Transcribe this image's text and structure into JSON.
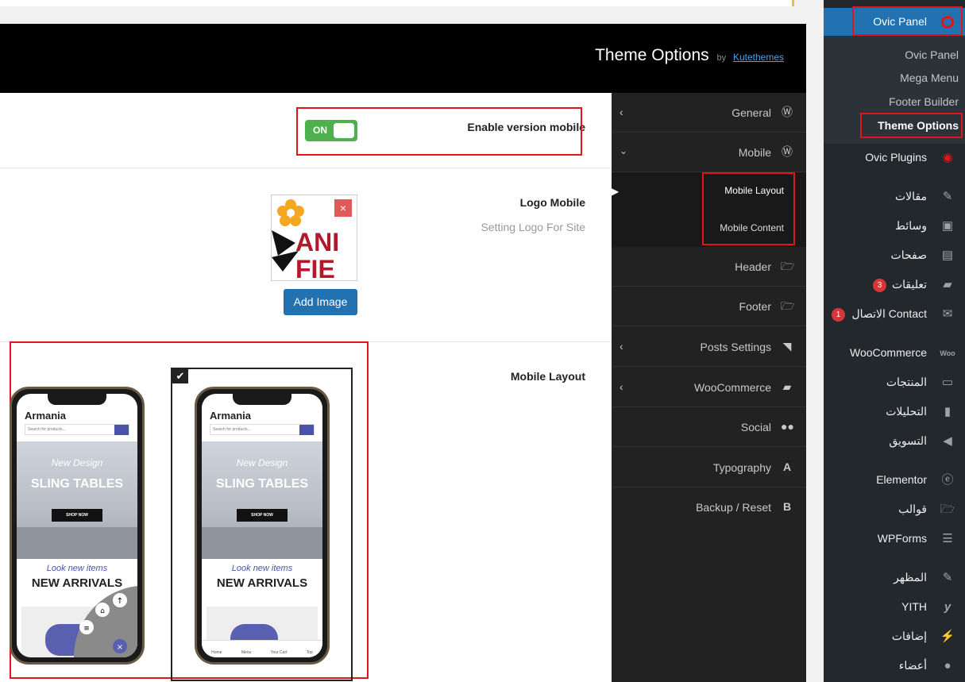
{
  "header": {
    "title": "Theme Options",
    "by": "by",
    "author": "Kutethemes"
  },
  "rows": {
    "enable_mobile": {
      "label": "Enable version mobile",
      "toggle": "ON"
    },
    "logo_mobile": {
      "label": "Logo Mobile",
      "sub": "Setting Logo For Site",
      "add_button": "Add Image",
      "remove": "×",
      "logo_text_1": "ANI",
      "logo_text_2": "FIE"
    },
    "mobile_layout": {
      "label": "Mobile Layout"
    }
  },
  "phones": [
    {
      "brand": "Armania",
      "search": "Search for products...",
      "hero_script": "New Design",
      "hero_title": "SLING TABLES",
      "shop": "SHOP NOW",
      "look": "Look new items",
      "arrivals": "NEW ARRIVALS"
    },
    {
      "brand": "Armania",
      "search": "Search for products...",
      "hero_script": "New Design",
      "hero_title": "SLING TABLES",
      "shop": "SHOP NOW",
      "look": "Look new items",
      "arrivals": "NEW ARRIVALS",
      "nav": [
        "Home",
        "Menu",
        "Your Cart",
        "Top"
      ]
    }
  ],
  "options_menu": {
    "items": [
      {
        "label": "General",
        "icon": "wordpress-icon"
      },
      {
        "label": "Mobile",
        "icon": "wordpress-icon"
      },
      {
        "label": "Header",
        "icon": "folder-icon"
      },
      {
        "label": "Footer",
        "icon": "folder-icon"
      },
      {
        "label": "Posts Settings",
        "icon": "rss-icon"
      },
      {
        "label": "WooCommerce",
        "icon": "bag-icon"
      },
      {
        "label": "Social",
        "icon": "users-icon"
      },
      {
        "label": "Typography",
        "icon": "typography-icon"
      },
      {
        "label": "Backup / Reset",
        "icon": "b-icon"
      }
    ],
    "sub": [
      "Mobile Layout",
      "Mobile Content"
    ]
  },
  "wp_sidebar": {
    "ovic_panel": "Ovic Panel",
    "submenu": [
      "Ovic Panel",
      "Mega Menu",
      "Footer Builder",
      "Theme Options"
    ],
    "items": [
      {
        "label": "Ovic Plugins"
      },
      {
        "label": "مقالات"
      },
      {
        "label": "وسائط"
      },
      {
        "label": "صفحات"
      },
      {
        "label": "تعليقات",
        "badge": "3"
      },
      {
        "label": "الاتصال Contact",
        "badge": "1"
      },
      {
        "label": "WooCommerce"
      },
      {
        "label": "المنتجات"
      },
      {
        "label": "التحليلات"
      },
      {
        "label": "التسويق"
      },
      {
        "label": "Elementor"
      },
      {
        "label": "قوالب"
      },
      {
        "label": "WPForms"
      },
      {
        "label": "المظهر"
      },
      {
        "label": "YITH"
      },
      {
        "label": "إضافات"
      },
      {
        "label": "أعضاء"
      }
    ]
  },
  "colors": {
    "accent": "#e0161f",
    "wp_blue": "#2271b1",
    "toggle_on": "#4db24d"
  }
}
